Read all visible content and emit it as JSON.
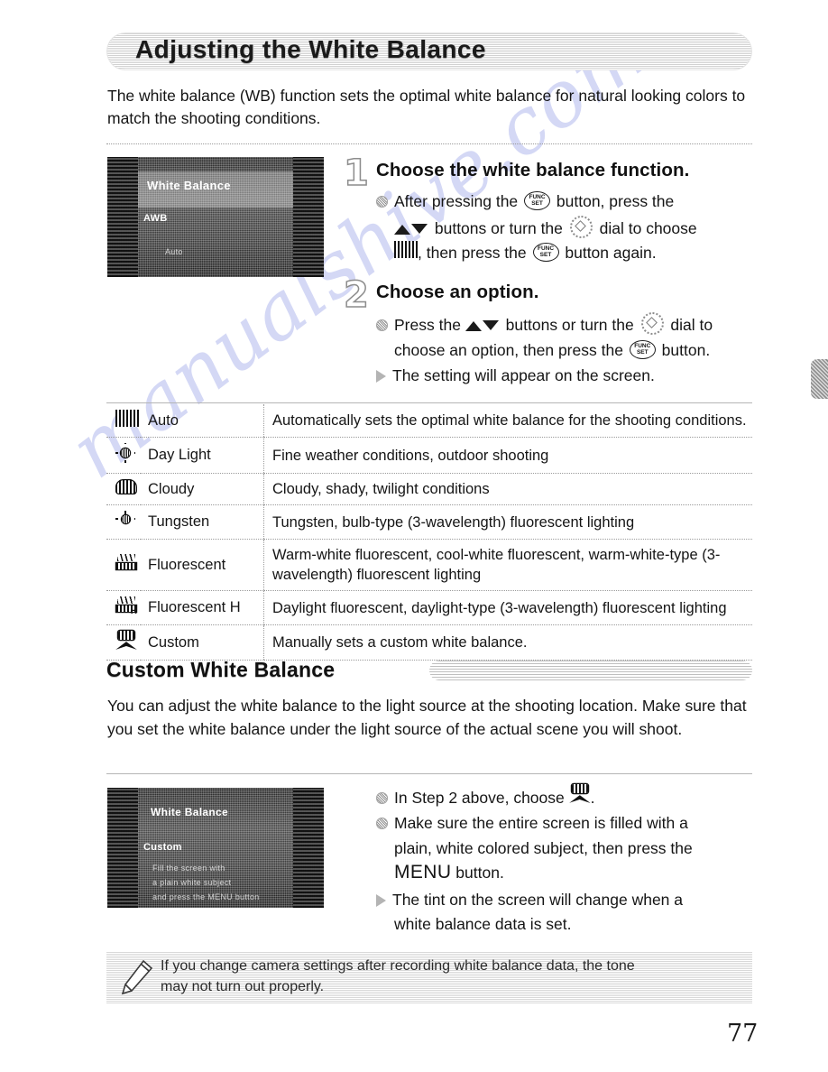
{
  "page": {
    "number": "77",
    "watermark": "manualshive.com"
  },
  "header": {
    "title": "Adjusting the White Balance"
  },
  "intro": "The white balance (WB) function sets the optimal white balance for natural looking colors to match the shooting conditions.",
  "steps": [
    {
      "number": "1",
      "heading": "Choose the white balance function.",
      "lines": [
        {
          "marker": "dot",
          "before": "After pressing the ",
          "glyph": "func-set-button",
          "middle": " button, press the ",
          "after": ""
        },
        {
          "marker": "none",
          "text_a": " buttons or turn the ",
          "text_b": " dial to choose"
        },
        {
          "marker": "none",
          "text_c": ", then press the ",
          "text_d": " button again."
        }
      ],
      "screen_label_top": "White Balance",
      "screen_label_mid": "AWB",
      "screen_label_bottom": "Auto"
    },
    {
      "number": "2",
      "heading": "Choose an option.",
      "lines": [
        {
          "marker": "dot",
          "a": "Press the ",
          "b": " buttons or turn the ",
          "c": " dial to"
        },
        {
          "marker": "none",
          "d": "choose an option, then press the ",
          "e": " button."
        },
        {
          "marker": "tri",
          "f": "The setting will appear on the screen."
        }
      ]
    }
  ],
  "table": {
    "rows": [
      {
        "icon": "awb-icon",
        "name": "Auto",
        "desc": "Automatically sets the optimal white balance for the shooting conditions."
      },
      {
        "icon": "day-light-icon",
        "name": "Day Light",
        "desc": "Fine weather conditions, outdoor shooting"
      },
      {
        "icon": "cloudy-icon",
        "name": "Cloudy",
        "desc": "Cloudy, shady, twilight conditions"
      },
      {
        "icon": "tungsten-icon",
        "name": "Tungsten",
        "desc": "Tungsten, bulb-type (3-wavelength) fluorescent lighting"
      },
      {
        "icon": "fluorescent-icon",
        "name": "Fluorescent",
        "desc": "Warm-white fluorescent, cool-white fluorescent, warm-white-type (3-wavelength) fluorescent lighting"
      },
      {
        "icon": "fluorescent-h-icon",
        "name": "Fluorescent H",
        "desc": "Daylight fluorescent, daylight-type (3-wavelength) fluorescent lighting"
      },
      {
        "icon": "custom-icon",
        "name": "Custom",
        "desc": "Manually sets a custom white balance."
      }
    ]
  },
  "subsection": {
    "title": "Custom White Balance",
    "paragraph": "You can adjust the white balance to the light source at the shooting location. Make sure that you set the white balance under the light source of the actual scene you will shoot.",
    "bullets": {
      "b1_a": "In Step 2 above, choose ",
      "b1_b": ".",
      "b2_l1": "Make sure the entire screen is filled with a",
      "b2_l2": "plain, white colored subject, then press the",
      "b2_menu": "MENU",
      "b2_l3": " button.",
      "b3_l1": "The tint on the screen will change when a",
      "b3_l2": "white balance data is set."
    },
    "screen_label_top": "White Balance",
    "screen_label_mid": "Custom",
    "screen_label_l1": "Fill the screen with",
    "screen_label_l2": "a plain white subject",
    "screen_label_l3": "and press the MENU button"
  },
  "note": {
    "line1": "If you change camera settings after recording white balance data, the tone",
    "line2": "may not turn out properly.",
    "icon": "pencil-icon"
  }
}
